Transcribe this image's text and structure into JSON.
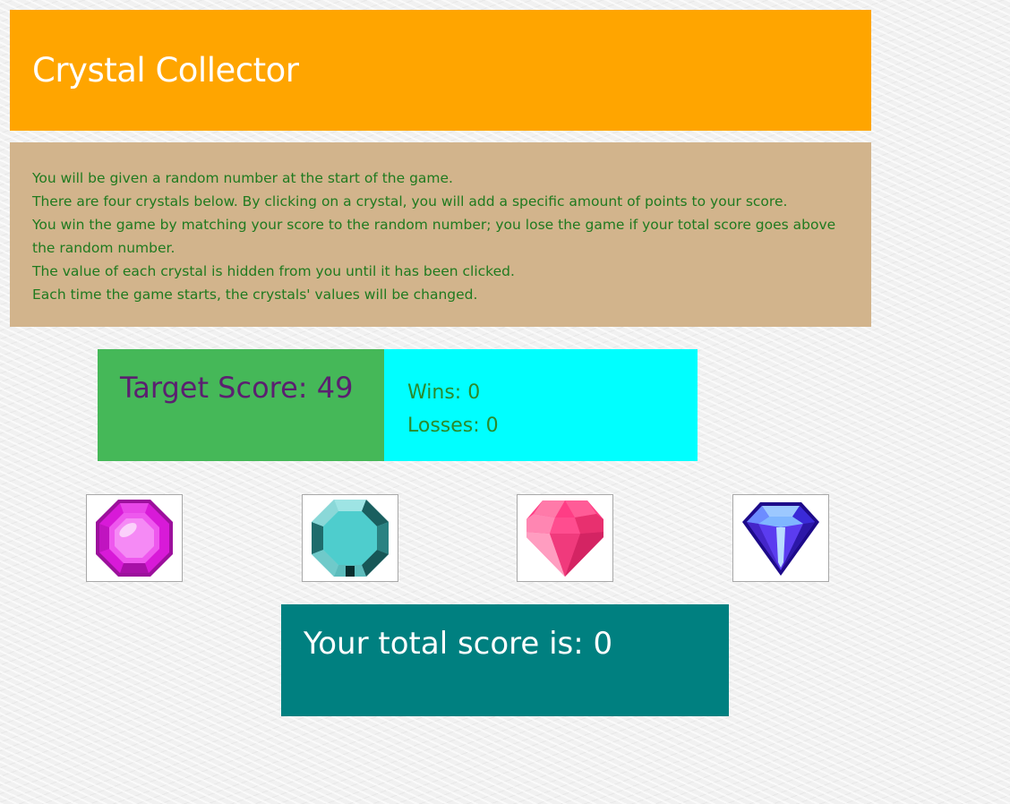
{
  "header": {
    "title": "Crystal Collector"
  },
  "instructions": [
    "You will be given a random number at the start of the game.",
    "There are four crystals below. By clicking on a crystal, you will add a specific amount of points to your score.",
    "You win the game by matching your score to the random number; you lose the game if your total score goes above the random number.",
    "The value of each crystal is hidden from you until it has been clicked.",
    "Each time the game starts, the crystals' values will be changed."
  ],
  "target": {
    "label": "Target Score:",
    "value": "49"
  },
  "stats": {
    "wins_label": "Wins:",
    "wins": "0",
    "losses_label": "Losses:",
    "losses": "0"
  },
  "crystals": [
    {
      "icon": "magenta-octagon-gem-icon",
      "color": "#d81ad8"
    },
    {
      "icon": "teal-round-gem-icon",
      "color": "#4ecdcd"
    },
    {
      "icon": "pink-heart-gem-icon",
      "color": "#ff3d85"
    },
    {
      "icon": "blue-diamond-gem-icon",
      "color": "#4b2bd6"
    }
  ],
  "score": {
    "label": "Your total score is:",
    "value": "0"
  },
  "colors": {
    "header": "#ffa500",
    "instructions_bg": "#d2b48c",
    "instructions_text": "#1f7a1f",
    "target_bg": "#45b858",
    "target_text": "#5b2070",
    "stats_bg": "#00ffff",
    "stats_text": "#2b8a2b",
    "score_bg": "#008080"
  }
}
